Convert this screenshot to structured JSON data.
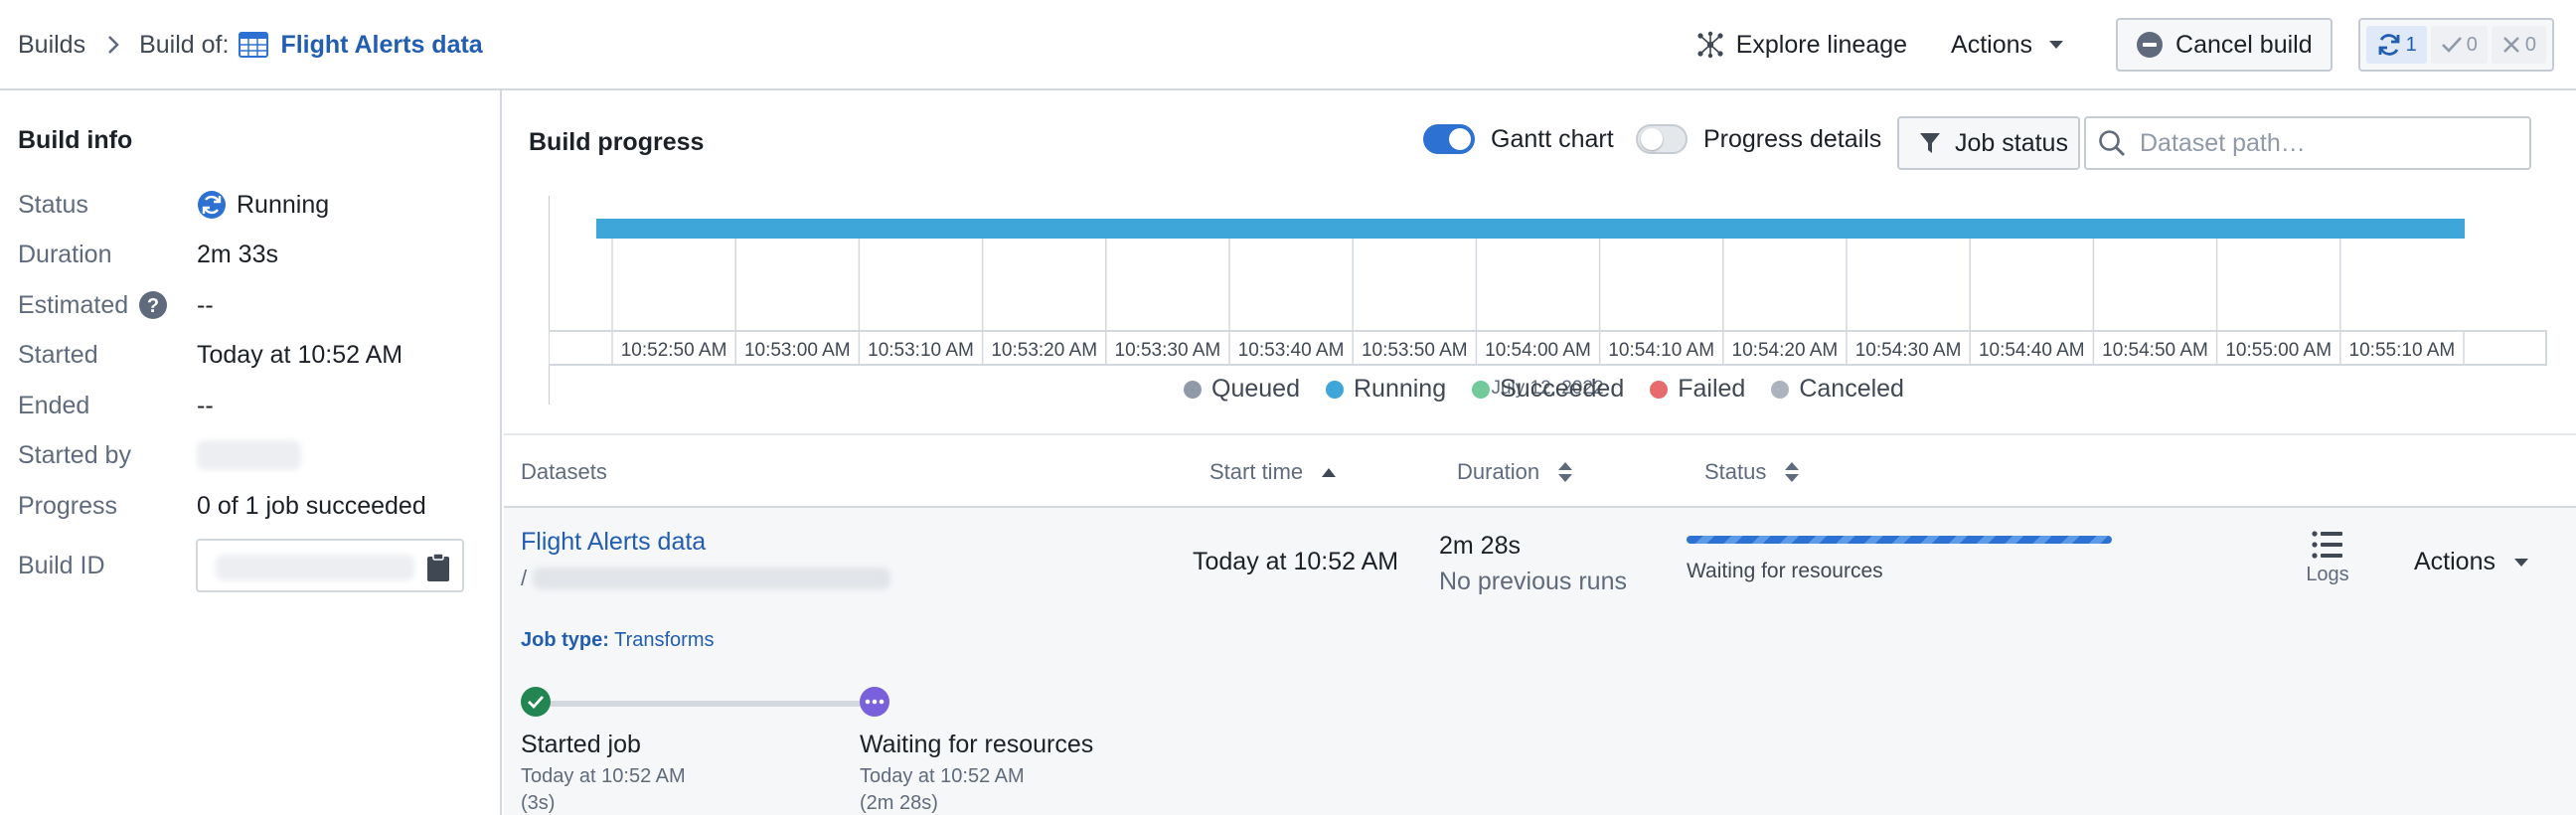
{
  "breadcrumb": {
    "root": "Builds",
    "build_of_label": "Build of:",
    "dataset_name": "Flight Alerts data"
  },
  "toolbar": {
    "explore_lineage": "Explore lineage",
    "actions": "Actions",
    "cancel_build": "Cancel build",
    "counts": {
      "running": "1",
      "succeeded": "0",
      "failed": "0"
    }
  },
  "build_info": {
    "title": "Build info",
    "rows": [
      {
        "key": "Status",
        "value": "Running"
      },
      {
        "key": "Duration",
        "value": "2m 33s"
      },
      {
        "key": "Estimated",
        "value": "--"
      },
      {
        "key": "Started",
        "value": "Today at 10:52 AM"
      },
      {
        "key": "Ended",
        "value": "--"
      },
      {
        "key": "Started by",
        "value": ""
      },
      {
        "key": "Progress",
        "value": "0 of 1 job succeeded"
      },
      {
        "key": "Build ID",
        "value": ""
      }
    ]
  },
  "build_progress": {
    "title": "Build progress",
    "gantt_toggle": {
      "label": "Gantt chart",
      "on": true
    },
    "details_toggle": {
      "label": "Progress details",
      "on": false
    },
    "job_status_button": "Job status",
    "search_placeholder": "Dataset path…",
    "gantt": {
      "ticks": [
        "10:52:50 AM",
        "10:53:00 AM",
        "10:53:10 AM",
        "10:53:20 AM",
        "10:53:30 AM",
        "10:53:40 AM",
        "10:53:50 AM",
        "10:54:00 AM",
        "10:54:10 AM",
        "10:54:20 AM",
        "10:54:30 AM",
        "10:54:40 AM",
        "10:54:50 AM",
        "10:55:00 AM",
        "10:55:10 AM"
      ],
      "date": "July 12, 2022",
      "bar_color": "#3fa6da"
    },
    "legend": [
      {
        "label": "Queued",
        "color": "#8f99a8"
      },
      {
        "label": "Running",
        "color": "#3fa6da"
      },
      {
        "label": "Succeeded",
        "color": "#72ca9b"
      },
      {
        "label": "Failed",
        "color": "#e76a6e"
      },
      {
        "label": "Canceled",
        "color": "#abb3bf"
      }
    ]
  },
  "table": {
    "headers": {
      "datasets": "Datasets",
      "start_time": "Start time",
      "duration": "Duration",
      "status": "Status"
    },
    "row": {
      "dataset": "Flight Alerts data",
      "path_prefix": "/",
      "start_time": "Today at 10:52 AM",
      "duration": "2m 28s",
      "duration_note": "No previous runs",
      "status": "Waiting for resources",
      "logs": "Logs",
      "actions": "Actions",
      "job_type_label": "Job type:",
      "job_type": "Transforms",
      "steps": [
        {
          "title": "Started job",
          "time": "Today at 10:52 AM",
          "elapsed": "(3s)"
        },
        {
          "title": "Waiting for resources",
          "time": "Today at 10:52 AM",
          "elapsed": "(2m 28s)"
        }
      ]
    }
  }
}
